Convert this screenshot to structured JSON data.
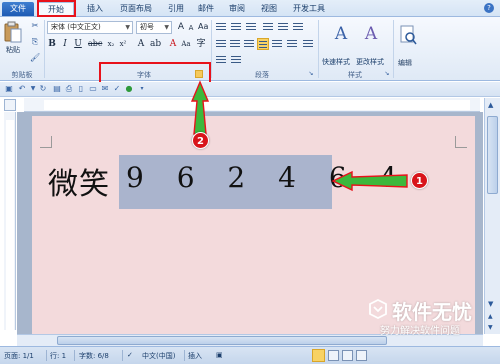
{
  "tabs": [
    {
      "label": "文件"
    },
    {
      "label": "开始"
    },
    {
      "label": "插入"
    },
    {
      "label": "页面布局"
    },
    {
      "label": "引用"
    },
    {
      "label": "邮件"
    },
    {
      "label": "审阅"
    },
    {
      "label": "视图"
    },
    {
      "label": "开发工具"
    }
  ],
  "ribbon": {
    "paste_label": "粘贴",
    "clipboard_group": "剪贴板",
    "font_name": "宋体 (中文正文)",
    "font_size": "初号",
    "font_group": "字体",
    "paragraph_group": "段落",
    "quick_styles_label": "快速样式",
    "change_styles_label": "更改样式",
    "styles_group": "样式",
    "editing_label": "编辑"
  },
  "document": {
    "plain_text": "微笑",
    "selected_text": "9 6 2 4 6 4"
  },
  "annotations": {
    "badge_1": "1",
    "badge_2": "2",
    "accent_color": "#e8121b",
    "arrow_color": "#3cb83c"
  },
  "status_bar": {
    "page": "页面: 1/1",
    "line": "行: 1",
    "word_count": "字数: 6/8",
    "language": "中文(中国)",
    "insert_mode": "插入"
  },
  "watermark": {
    "title": "软件无忧",
    "subtitle": "努力解决软件问题"
  }
}
